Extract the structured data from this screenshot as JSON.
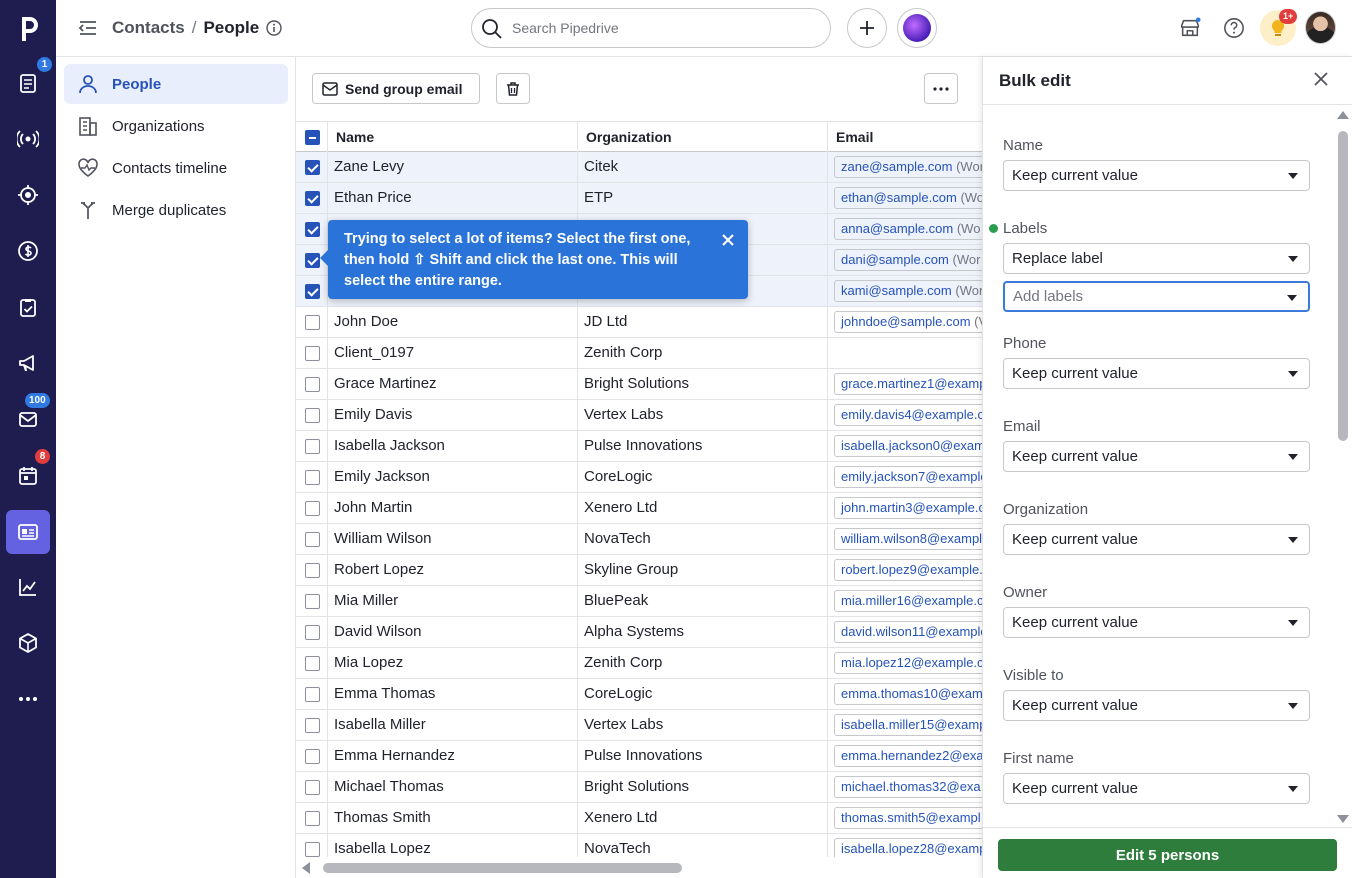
{
  "rail": {
    "logo": "p",
    "badges": {
      "mail": "1",
      "inbox": "100",
      "activities": "8"
    }
  },
  "topbar": {
    "breadcrumb_parent": "Contacts",
    "breadcrumb_sep": "/",
    "breadcrumb_current": "People",
    "search_placeholder": "Search Pipedrive",
    "notif_badge": "1+"
  },
  "leftnav": {
    "items": [
      {
        "label": "People",
        "icon": "person-icon"
      },
      {
        "label": "Organizations",
        "icon": "building-icon"
      },
      {
        "label": "Contacts timeline",
        "icon": "heartbeat-icon"
      },
      {
        "label": "Merge duplicates",
        "icon": "merge-icon"
      }
    ]
  },
  "toolbar": {
    "send_email": "Send group email"
  },
  "grid": {
    "headers": [
      "Name",
      "Organization",
      "Email"
    ],
    "rows": [
      {
        "name": "Zane Levy",
        "org": "Citek",
        "email": "zane@sample.com",
        "tag": "(Wor",
        "selected": true
      },
      {
        "name": "Ethan Price",
        "org": "ETP",
        "email": "ethan@sample.com",
        "tag": "(Wo",
        "selected": true
      },
      {
        "name": "",
        "org": "",
        "email": "anna@sample.com",
        "tag": "(Wo",
        "selected": true
      },
      {
        "name": "",
        "org": "",
        "email": "dani@sample.com",
        "tag": "(Wor",
        "selected": true
      },
      {
        "name": "",
        "org": "",
        "email": "kami@sample.com",
        "tag": "(Wor",
        "selected": true
      },
      {
        "name": "John Doe",
        "org": "JD Ltd",
        "email": "johndoe@sample.com",
        "tag": "(V",
        "selected": false
      },
      {
        "name": "Client_0197",
        "org": "Zenith Corp",
        "email": "",
        "tag": "",
        "selected": false
      },
      {
        "name": "Grace Martinez",
        "org": "Bright Solutions",
        "email": "grace.martinez1@examp",
        "tag": "",
        "selected": false
      },
      {
        "name": "Emily Davis",
        "org": "Vertex Labs",
        "email": "emily.davis4@example.c",
        "tag": "",
        "selected": false
      },
      {
        "name": "Isabella Jackson",
        "org": "Pulse Innovations",
        "email": "isabella.jackson0@exam",
        "tag": "",
        "selected": false
      },
      {
        "name": "Emily Jackson",
        "org": "CoreLogic",
        "email": "emily.jackson7@example",
        "tag": "",
        "selected": false
      },
      {
        "name": "John Martin",
        "org": "Xenero Ltd",
        "email": "john.martin3@example.c",
        "tag": "",
        "selected": false
      },
      {
        "name": "William Wilson",
        "org": "NovaTech",
        "email": "william.wilson8@exampl",
        "tag": "",
        "selected": false
      },
      {
        "name": "Robert Lopez",
        "org": "Skyline Group",
        "email": "robert.lopez9@example.",
        "tag": "",
        "selected": false
      },
      {
        "name": "Mia Miller",
        "org": "BluePeak",
        "email": "mia.miller16@example.co",
        "tag": "",
        "selected": false
      },
      {
        "name": "David Wilson",
        "org": "Alpha Systems",
        "email": "david.wilson11@example",
        "tag": "",
        "selected": false
      },
      {
        "name": "Mia Lopez",
        "org": "Zenith Corp",
        "email": "mia.lopez12@example.co",
        "tag": "",
        "selected": false
      },
      {
        "name": "Emma Thomas",
        "org": "CoreLogic",
        "email": "emma.thomas10@examp",
        "tag": "",
        "selected": false
      },
      {
        "name": "Isabella Miller",
        "org": "Vertex Labs",
        "email": "isabella.miller15@examp",
        "tag": "",
        "selected": false
      },
      {
        "name": "Emma Hernandez",
        "org": "Pulse Innovations",
        "email": "emma.hernandez2@exa",
        "tag": "",
        "selected": false
      },
      {
        "name": "Michael Thomas",
        "org": "Bright Solutions",
        "email": "michael.thomas32@exa",
        "tag": "",
        "selected": false
      },
      {
        "name": "Thomas Smith",
        "org": "Xenero Ltd",
        "email": "thomas.smith5@exampl",
        "tag": "",
        "selected": false
      },
      {
        "name": "Isabella Lopez",
        "org": "NovaTech",
        "email": "isabella.lopez28@examp",
        "tag": "",
        "selected": false
      }
    ]
  },
  "tooltip": {
    "text": "Trying to select a lot of items? Select the first one, then hold ⇧ Shift and click the last one. This will select the entire range."
  },
  "panel": {
    "title": "Bulk edit",
    "fields": [
      {
        "label": "Name",
        "value": "Keep current value"
      },
      {
        "label": "Labels",
        "value": "Replace label",
        "extra_placeholder": "Add labels",
        "changed": true
      },
      {
        "label": "Phone",
        "value": "Keep current value"
      },
      {
        "label": "Email",
        "value": "Keep current value"
      },
      {
        "label": "Organization",
        "value": "Keep current value"
      },
      {
        "label": "Owner",
        "value": "Keep current value"
      },
      {
        "label": "Visible to",
        "value": "Keep current value"
      },
      {
        "label": "First name",
        "value": "Keep current value"
      }
    ],
    "submit": "Edit 5 persons"
  },
  "colors": {
    "rail": "#1f1d4f",
    "accent": "#2553b8",
    "tooltip": "#2a74d9",
    "submit": "#2e7d3d"
  }
}
